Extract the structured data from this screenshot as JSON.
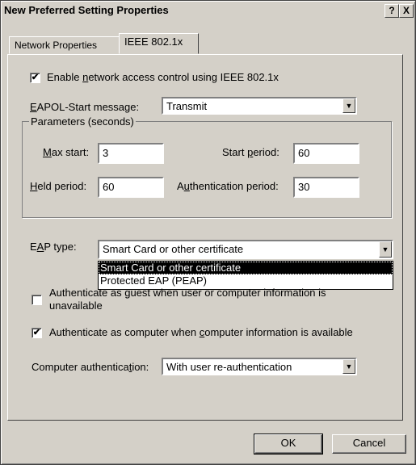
{
  "window": {
    "title": "New Preferred Setting Properties",
    "help": "?",
    "close": "X"
  },
  "tabs": [
    {
      "label": "Network Properties"
    },
    {
      "label": "IEEE 802.1x"
    }
  ],
  "enable": {
    "checked": true,
    "pre": "Enable ",
    "key": "n",
    "post": "etwork access control using IEEE 802.1x"
  },
  "eapol": {
    "key": "E",
    "label": "APOL-Start message:",
    "value": "Transmit"
  },
  "params": {
    "legend": "Parameters (seconds)",
    "max_start": {
      "key": "M",
      "label": "ax start:",
      "value": "3"
    },
    "start_period": {
      "pre": "Start ",
      "key": "p",
      "post": "eriod:",
      "value": "60"
    },
    "held_period": {
      "key": "H",
      "label": "eld period:",
      "value": "60"
    },
    "auth_period": {
      "pre": "A",
      "key": "u",
      "post": "thentication period:",
      "value": "30"
    }
  },
  "eap_type": {
    "pre": "E",
    "key": "A",
    "post": "P type:",
    "value": "Smart Card or other certificate",
    "options": [
      "Smart Card or other certificate",
      "Protected EAP (PEAP)"
    ]
  },
  "guest": {
    "checked": false,
    "pre": "Authenticate as ",
    "key": "g",
    "post": "uest when user or computer information is",
    "line2": "unavailable"
  },
  "computer": {
    "checked": true,
    "pre": "Authenticate as computer when ",
    "key": "c",
    "post": "omputer information is available"
  },
  "computer_auth": {
    "pre": "Computer authentica",
    "key": "t",
    "post": "ion:",
    "value": "With user re-authentication"
  },
  "buttons": {
    "ok": "OK",
    "cancel": "Cancel"
  }
}
